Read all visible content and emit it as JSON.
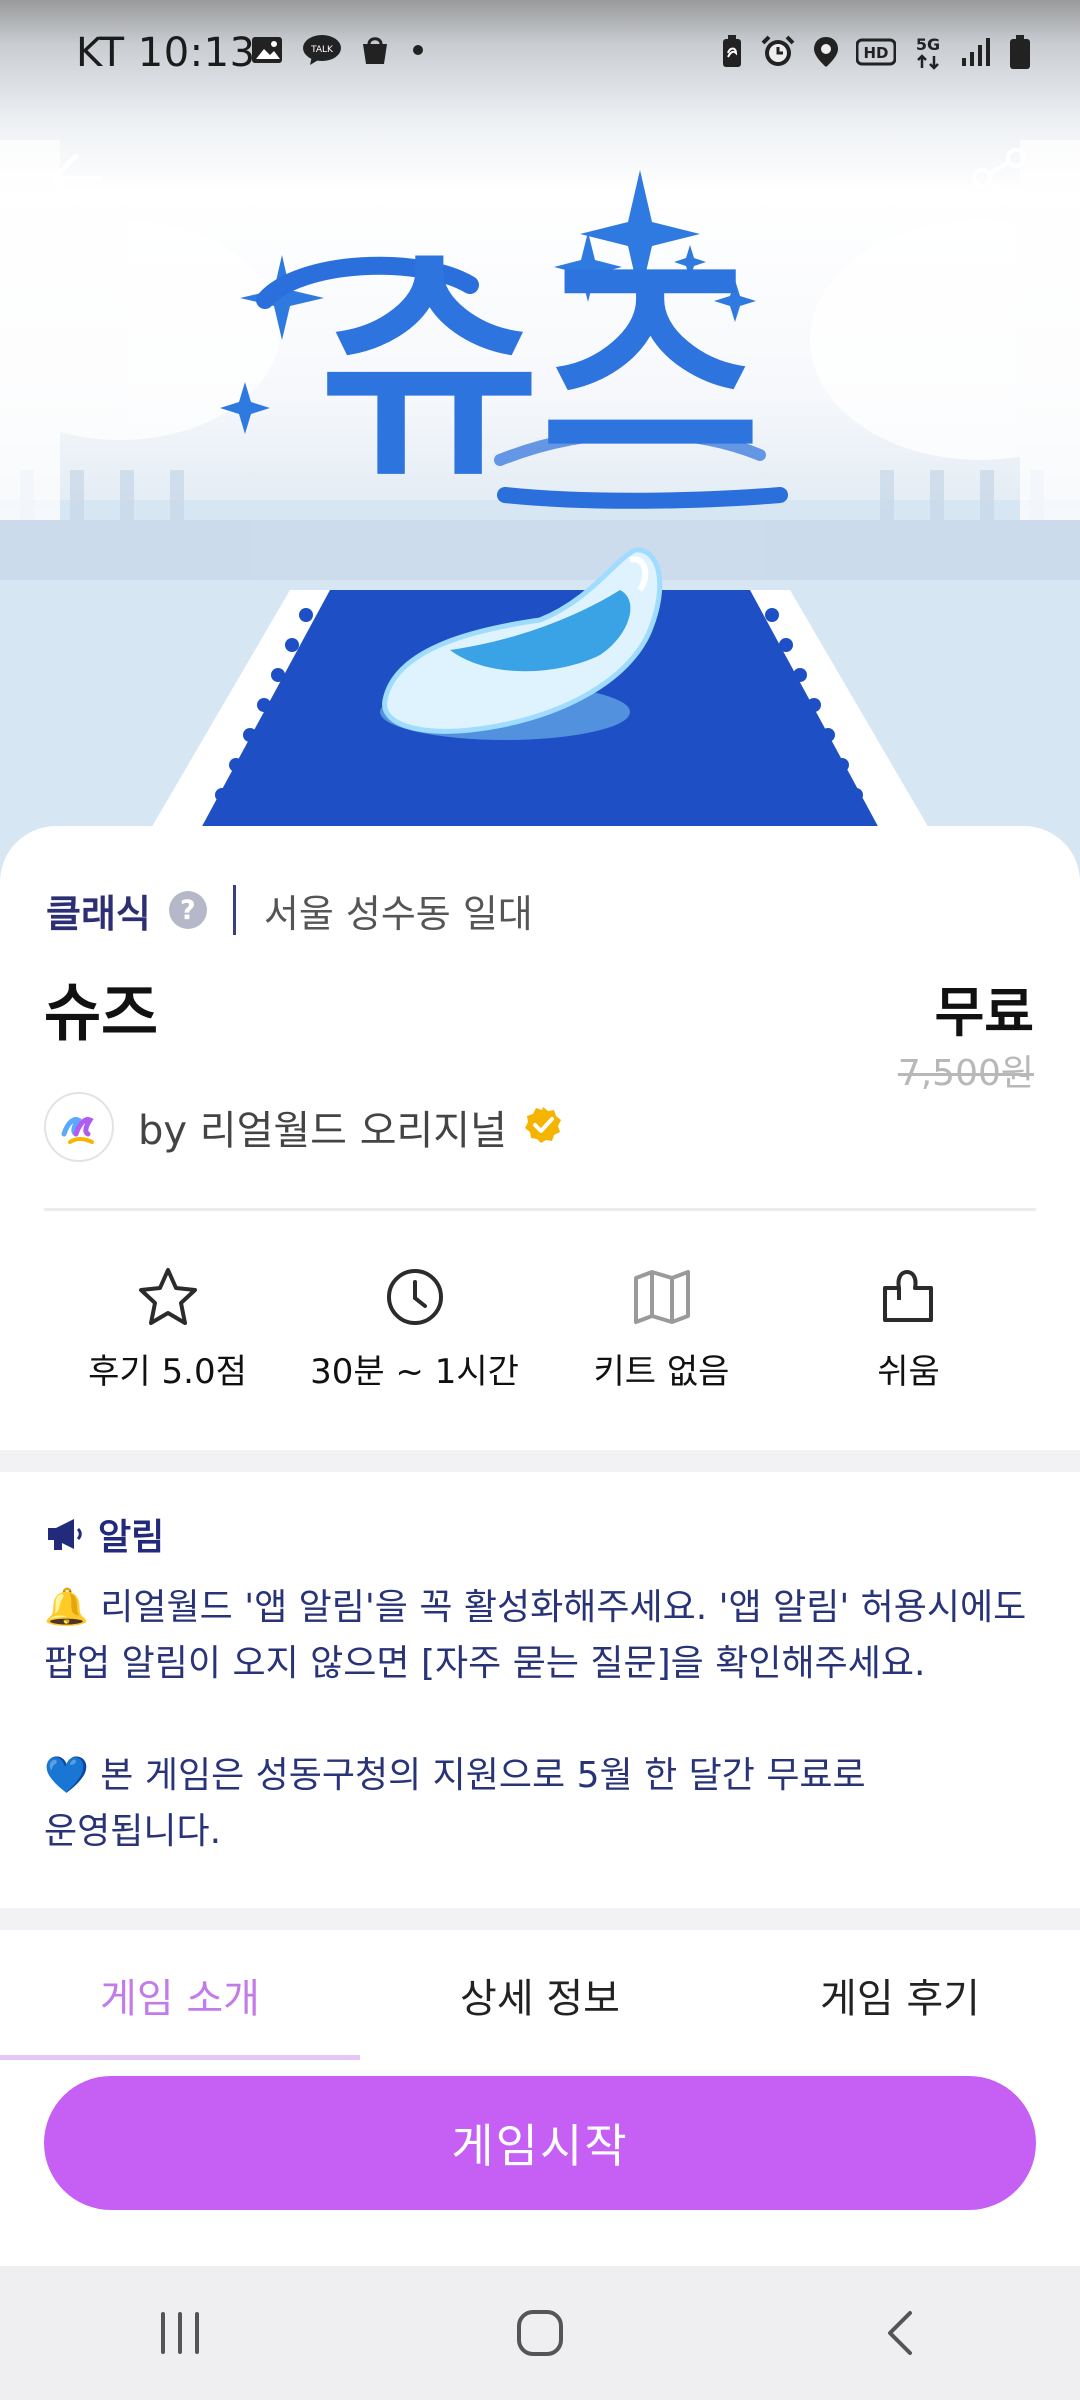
{
  "status_bar": {
    "carrier_time": "KT 10:13",
    "icons_left": [
      "image-icon",
      "talk-icon",
      "bag-icon",
      "dot-icon"
    ],
    "icons_right": [
      "battery-saver-icon",
      "alarm-icon",
      "location-icon",
      "hd-icon",
      "5g-icon",
      "signal-icon",
      "battery-icon"
    ],
    "badge_talk": "TALK",
    "badge_hd": "HD",
    "badge_5g": "5G"
  },
  "hero": {
    "logo_text": "슈즈",
    "back_icon": "arrow-left-icon",
    "share_icon": "share-icon"
  },
  "info": {
    "category": "클래식",
    "help": "?",
    "location": "서울 성수동 일대",
    "title": "슈즈",
    "price": "무료",
    "original_price": "7,500원",
    "author": "by 리얼월드 오리지널"
  },
  "stats": [
    {
      "icon": "star-icon",
      "label": "후기 5.0점"
    },
    {
      "icon": "clock-icon",
      "label": "30분 ~ 1시간"
    },
    {
      "icon": "map-icon",
      "label": "키트 없음"
    },
    {
      "icon": "puzzle-icon",
      "label": "쉬움"
    }
  ],
  "notice": {
    "heading": "알림",
    "paragraph1": "🔔 리얼월드 '앱 알림'을 꼭 활성화해주세요. '앱 알림' 허용시에도\n팝업 알림이 오지 않으면 [자주 묻는 질문]을 확인해주세요.",
    "paragraph2": "💙 본 게임은 성동구청의 지원으로 5월 한 달간 무료로\n운영됩니다."
  },
  "tabs": [
    {
      "label": "게임 소개",
      "active": true
    },
    {
      "label": "상세 정보",
      "active": false
    },
    {
      "label": "게임 후기",
      "active": false
    }
  ],
  "start_button": "게임시작",
  "colors": {
    "accent": "#c660f5",
    "tab_active": "#c27be9",
    "navy": "#2c2f73",
    "verified": "#f4b400"
  },
  "nav_bar": [
    "recents-icon",
    "home-icon",
    "back-icon"
  ]
}
